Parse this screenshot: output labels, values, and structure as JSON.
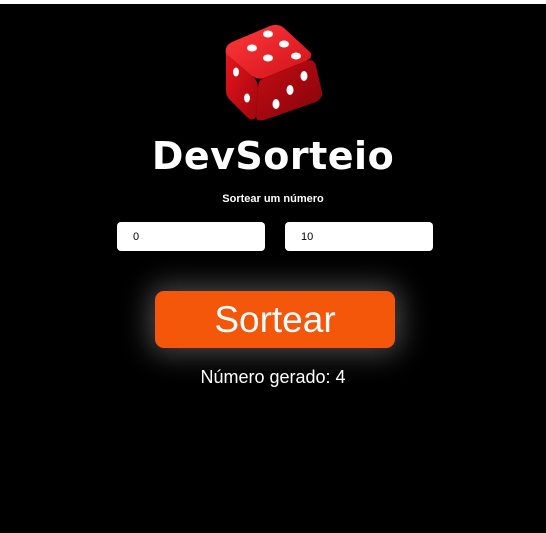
{
  "app": {
    "title": "DevSorteio",
    "logo_icon": "red-dice-icon"
  },
  "form": {
    "subtitle": "Sortear um número",
    "min_value": "0",
    "max_value": "10",
    "button_label": "Sortear"
  },
  "result": {
    "text": "Número gerado: 4"
  },
  "colors": {
    "background": "#000000",
    "button": "#f4560a",
    "dice": "#e0141b"
  }
}
